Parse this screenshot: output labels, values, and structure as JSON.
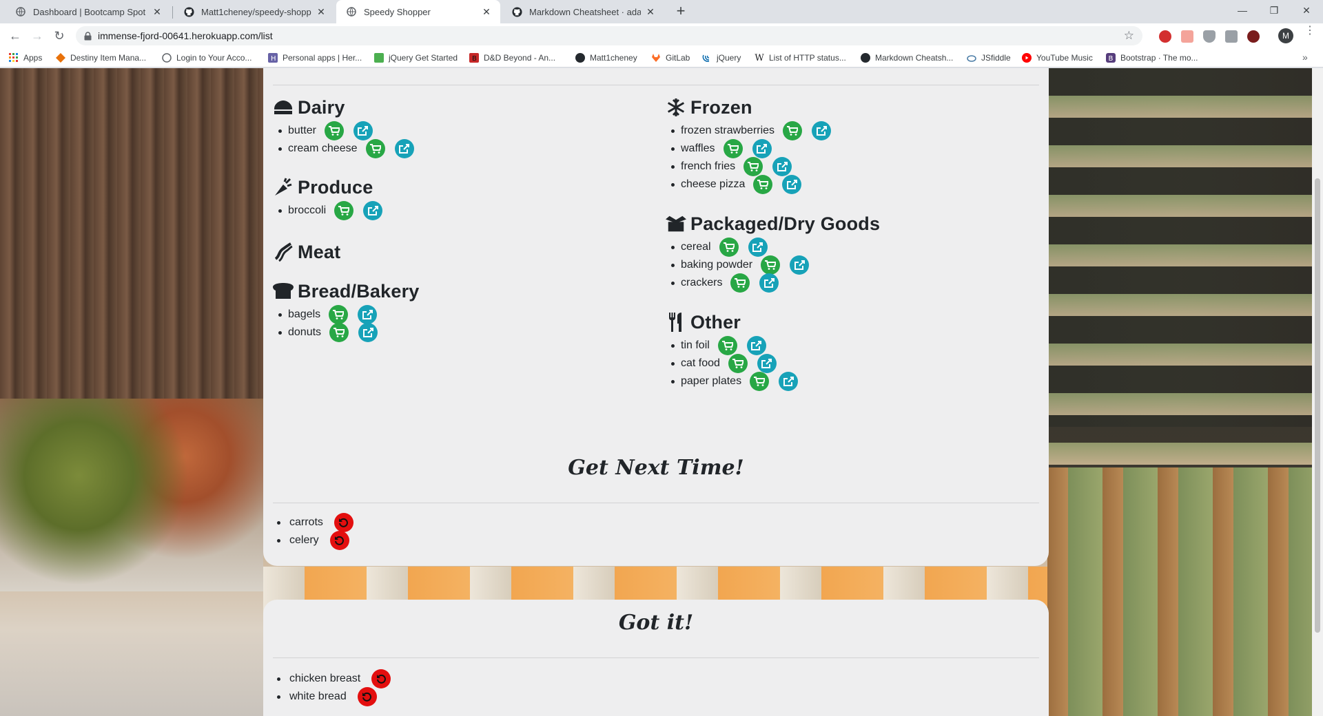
{
  "browser": {
    "tabs": [
      {
        "title": "Dashboard | Bootcamp Spot",
        "active": false
      },
      {
        "title": "Matt1cheney/speedy-shopper",
        "active": false
      },
      {
        "title": "Speedy Shopper",
        "active": true
      },
      {
        "title": "Markdown Cheatsheet · adam-p/",
        "active": false
      }
    ],
    "url": "immense-fjord-00641.herokuapp.com/list",
    "profile_initial": "M",
    "bookmarks": [
      "Apps",
      "Destiny Item Mana...",
      "Login to Your Acco...",
      "Personal apps | Her...",
      "jQuery Get Started",
      "D&D Beyond - An...",
      "Matt1cheney",
      "GitLab",
      "jQuery",
      "List of HTTP status...",
      "Markdown Cheatsh...",
      "JSfiddle",
      "YouTube Music",
      "Bootstrap · The mo..."
    ]
  },
  "categories_left": [
    {
      "name": "Dairy",
      "icon": "dairy-icon",
      "items": [
        "butter",
        "cream cheese"
      ]
    },
    {
      "name": "Produce",
      "icon": "carrot-icon",
      "items": [
        "broccoli"
      ]
    },
    {
      "name": "Meat",
      "icon": "bacon-icon",
      "items": []
    },
    {
      "name": "Bread/Bakery",
      "icon": "bread-icon",
      "items": [
        "bagels",
        "donuts"
      ]
    }
  ],
  "categories_right": [
    {
      "name": "Frozen",
      "icon": "snowflake-icon",
      "items": [
        "frozen strawberries",
        "waffles",
        "french fries",
        "cheese pizza"
      ]
    },
    {
      "name": "Packaged/Dry Goods",
      "icon": "box-open-icon",
      "items": [
        "cereal",
        "baking powder",
        "crackers"
      ]
    },
    {
      "name": "Other",
      "icon": "utensils-icon",
      "items": [
        "tin foil",
        "cat food",
        "paper plates"
      ]
    }
  ],
  "get_next_time": {
    "title": "Get Next Time!",
    "items": [
      "carrots",
      "celery"
    ]
  },
  "got_it": {
    "title": "Got it!",
    "items": [
      "chicken breast",
      "white bread"
    ]
  },
  "colors": {
    "cart_button": "#28a745",
    "share_button": "#17a2b8",
    "undo_button": "#e30f0f",
    "card_background": "#eeeeef"
  }
}
